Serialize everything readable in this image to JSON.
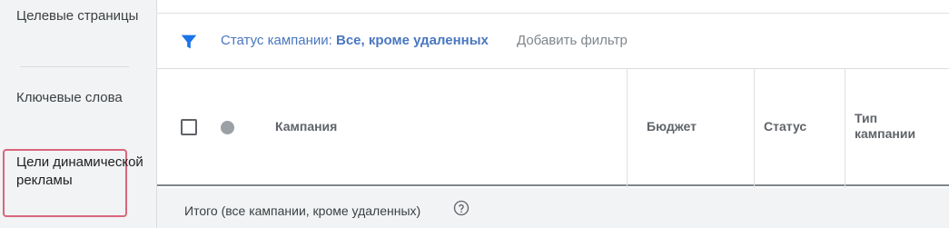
{
  "sidebar": {
    "items": [
      {
        "label": "Целевые страницы"
      },
      {
        "label": "Ключевые слова"
      },
      {
        "label": "Цели динамической рекламы"
      }
    ]
  },
  "filter": {
    "label": "Статус кампании:",
    "value": "Все, кроме удаленных",
    "add_filter": "Добавить фильтр",
    "icon": "filter-icon"
  },
  "table": {
    "columns": {
      "campaign": "Кампания",
      "budget": "Бюджет",
      "status": "Статус",
      "type": "Тип кампании"
    },
    "total_label": "Итого (все кампании, кроме удаленных)"
  },
  "colors": {
    "accent": "#4a77c0",
    "filter_icon": "#1a73e8",
    "highlight": "#d9667c"
  }
}
